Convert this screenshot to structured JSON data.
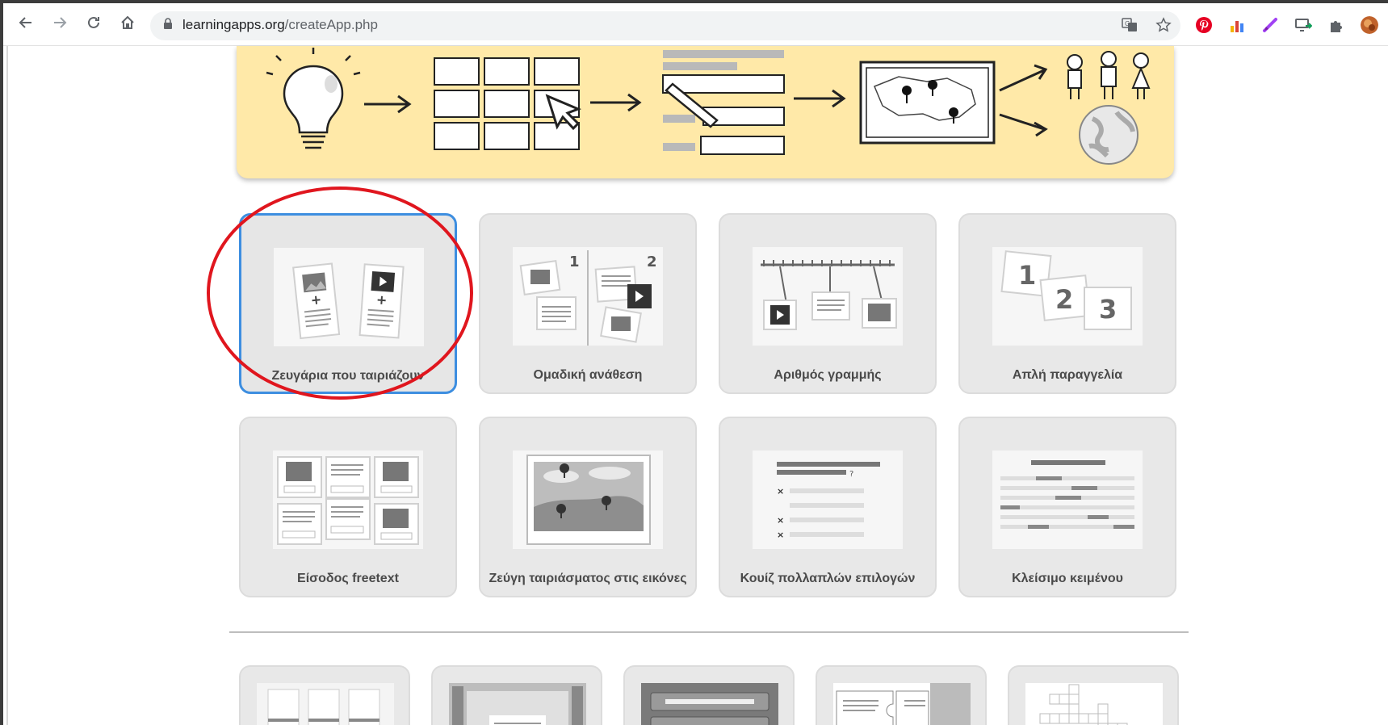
{
  "browser": {
    "url_host": "learningapps.org",
    "url_path": "/createApp.php"
  },
  "app_types": [
    {
      "label": "Ζευγάρια που ταιριάζουν",
      "selected": true
    },
    {
      "label": "Ομαδική ανάθεση"
    },
    {
      "label": "Αριθμός γραμμής"
    },
    {
      "label": "Απλή παραγγελία"
    },
    {
      "label": "Είσοδος freetext"
    },
    {
      "label": "Ζεύγη ταιριάσματος στις εικόνες"
    },
    {
      "label": "Κουίζ πολλαπλών επιλογών"
    },
    {
      "label": "Κλείσιμο κειμένου"
    }
  ],
  "thumb_numbers": {
    "group_1": "1",
    "group_2": "2",
    "order_1": "1",
    "order_2": "2",
    "order_3": "3"
  },
  "colors": {
    "selected_border": "#3d8ee0",
    "annotation_circle": "#e0161e",
    "hero_background": "#ffe9a8"
  }
}
